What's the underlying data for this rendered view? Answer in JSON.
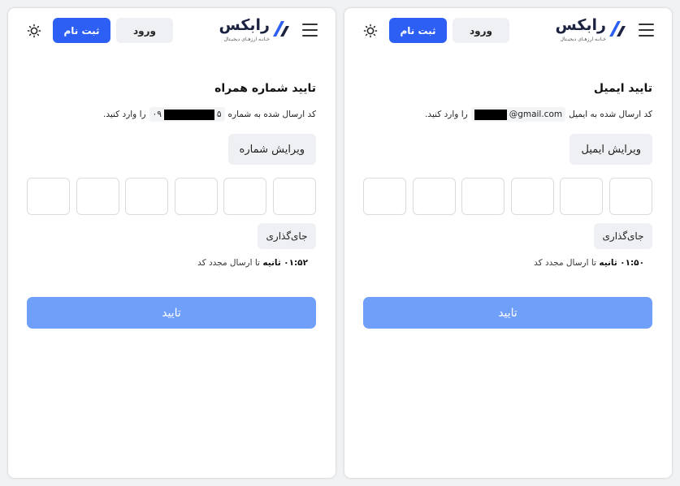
{
  "header": {
    "logo_name": "رابکس",
    "logo_tagline": "خـانـه ارزهـای دیجیـتال",
    "login_label": "ورود",
    "signup_label": "ثبت نام",
    "brand_color": "#2d5ff5",
    "icons": {
      "theme": "sun-icon",
      "menu": "hamburger-menu-icon"
    }
  },
  "phone_panel": {
    "title": "تایید شماره همراه",
    "desc_before": "کد ارسال شده به شماره",
    "contact_prefix": "۰۹",
    "contact_suffix": "۵",
    "desc_after": "را وارد کنید.",
    "edit_label": "ویرایش شماره",
    "otp_values": [
      "",
      "",
      "",
      "",
      "",
      ""
    ],
    "paste_label": "جای‌گذاری",
    "timer": "۰۱:۵۲",
    "timer_unit": "ثانیه",
    "timer_text": "تا ارسال مجدد کد",
    "confirm_label": "تایید"
  },
  "email_panel": {
    "title": "تایید ایمیل",
    "desc_before": "کد ارسال شده به ایمیل",
    "contact_suffix": "@gmail.com",
    "desc_after": "را وارد کنید.",
    "edit_label": "ویرایش ایمیل",
    "otp_values": [
      "",
      "",
      "",
      "",
      "",
      ""
    ],
    "paste_label": "جای‌گذاری",
    "timer": "۰۱:۵۰",
    "timer_unit": "ثانیه",
    "timer_text": "تا ارسال مجدد کد",
    "confirm_label": "تایید"
  }
}
